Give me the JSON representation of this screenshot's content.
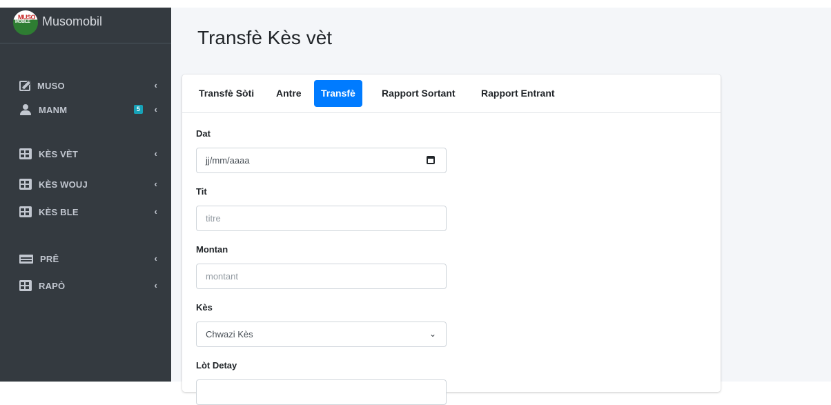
{
  "brand": {
    "logo_line1": "MUSO",
    "logo_line2": "MOBILE",
    "name": "Musomobil"
  },
  "sidebar": {
    "items": [
      {
        "label": "MUSO",
        "icon": "edit-icon"
      },
      {
        "label": "MANM",
        "icon": "user-icon",
        "badge": "5"
      },
      {
        "label": "KÈS VÈT",
        "icon": "table-icon"
      },
      {
        "label": "KÈS WOUJ",
        "icon": "table-icon"
      },
      {
        "label": "KÈS BLE",
        "icon": "table-icon"
      },
      {
        "label": "PRÊ",
        "icon": "credit-card-icon"
      },
      {
        "label": "RAPÒ",
        "icon": "table-icon"
      }
    ],
    "chevron": "‹"
  },
  "page": {
    "title": "Transfè Kès vèt"
  },
  "tabs": [
    {
      "label": "Transfè Sòti",
      "active": false
    },
    {
      "label": "Antre",
      "active": false
    },
    {
      "label": "Transfè",
      "active": true
    },
    {
      "label": "Rapport Sortant",
      "active": false
    },
    {
      "label": "Rapport Entrant",
      "active": false
    }
  ],
  "form": {
    "date": {
      "label": "Dat",
      "placeholder": "jj/mm/aaaa"
    },
    "title": {
      "label": "Tit",
      "placeholder": "titre"
    },
    "amount": {
      "label": "Montan",
      "placeholder": "montant"
    },
    "account": {
      "label": "Kès",
      "selected": "Chwazi Kès"
    },
    "details": {
      "label": "Lòt Detay"
    }
  },
  "colors": {
    "sidebar_bg": "#343a40",
    "active_tab": "#007bff",
    "badge": "#17a2b8"
  }
}
